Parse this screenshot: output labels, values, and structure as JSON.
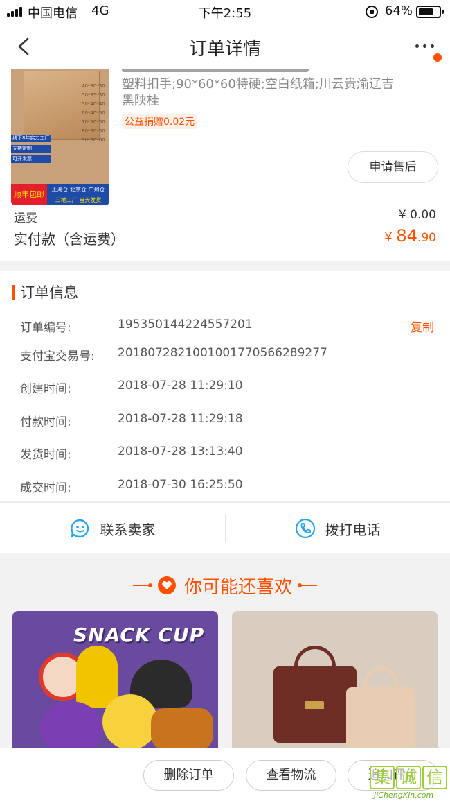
{
  "status_bar": {
    "carrier": "中国电信",
    "network": "4G",
    "time": "下午2:55",
    "battery": "64%"
  },
  "nav": {
    "title": "订单详情"
  },
  "product": {
    "spec": "塑料扣手;90*60*60特硬;空白纸箱;川云贵渝辽吉黑陕桂",
    "charity_tag": "公益捐赠0.02元",
    "after_sale_label": "申请售后",
    "thumb": {
      "chips": [
        "线下8年实力工厂",
        "支持定制",
        "可开发票"
      ],
      "free_shipping": "顺丰包邮",
      "warehouses": "上海仓 北京仓 广州仓",
      "factory_note": "三地工厂 当天发货",
      "sizes": [
        "40*30*30",
        "50*35*30",
        "50*40*40",
        "60*40*50",
        "70*50*50",
        "80*60*50",
        "90*60*60"
      ]
    }
  },
  "payment": {
    "shipping_label": "运费",
    "shipping_value": "¥ 0.00",
    "paid_label": "实付款（含运费）",
    "paid_currency": "¥ ",
    "paid_int": "84",
    "paid_dec": ".90"
  },
  "order_info": {
    "title": "订单信息",
    "copy_label": "复制",
    "rows": [
      {
        "label": "订单编号:",
        "value": "195350144224557201"
      },
      {
        "label": "支付宝交易号:",
        "value": "2018072821001001770566289277"
      },
      {
        "label": "创建时间:",
        "value": "2018-07-28 11:29:10"
      },
      {
        "label": "付款时间:",
        "value": "2018-07-28 11:29:18"
      },
      {
        "label": "发货时间:",
        "value": "2018-07-28 13:13:40"
      },
      {
        "label": "成交时间:",
        "value": "2018-07-30 16:25:50"
      }
    ]
  },
  "contact": {
    "seller_label": "联系卖家",
    "phone_label": "拨打电话"
  },
  "recommend": {
    "title": "你可能还喜欢",
    "cards": [
      {
        "text": "SNACK CUP"
      },
      {
        "text": ""
      }
    ]
  },
  "bottom_bar": {
    "delete_label": "删除订单",
    "logistics_label": "查看物流",
    "review_label": "追加评价"
  },
  "watermark": {
    "glyphs": [
      "集",
      "诚",
      "信"
    ],
    "url": "JiChengXin.com"
  },
  "colors": {
    "accent": "#ff5000",
    "contact_icon": "#2aa5e8"
  }
}
